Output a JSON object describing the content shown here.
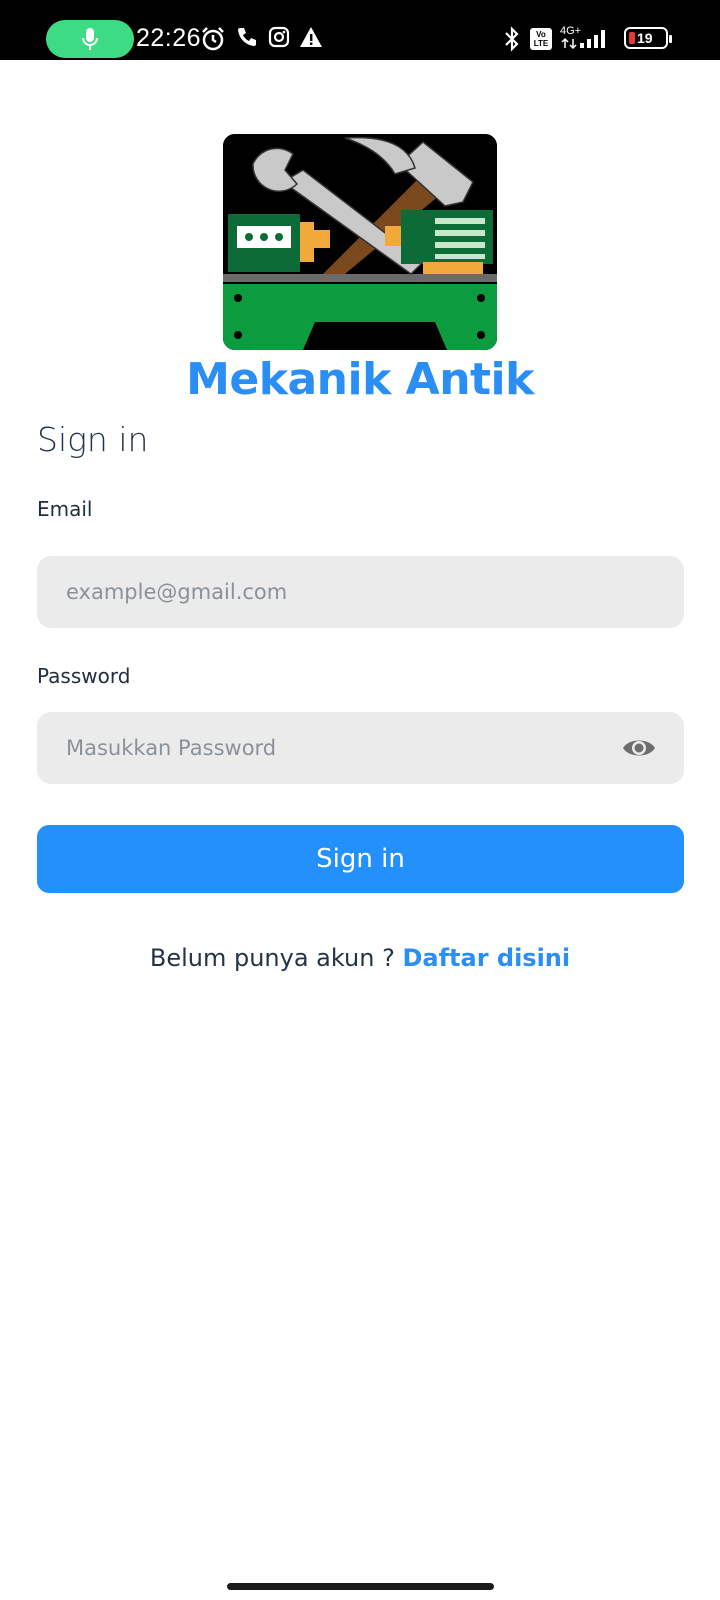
{
  "status_bar": {
    "time": "22:26",
    "battery_level": "19",
    "network": "4G+",
    "volte": "Vo LTE"
  },
  "app": {
    "name": "Mekanik Antik",
    "brand_color": "#2a8ef5"
  },
  "form": {
    "heading": "Sign in",
    "email_label": "Email",
    "email_placeholder": "example@gmail.com",
    "email_value": "",
    "password_label": "Password",
    "password_placeholder": "Masukkan Password",
    "password_value": "",
    "submit_label": "Sign in",
    "submit_color": "#2490fb"
  },
  "register": {
    "prompt": "Belum punya akun ? ",
    "link": "Daftar disini"
  },
  "icons": {
    "status_bar": [
      "mic-icon",
      "alarm-icon",
      "phone-icon",
      "instagram-icon",
      "warning-icon",
      "bluetooth-icon",
      "volte-icon",
      "signal-icon",
      "battery-icon"
    ],
    "password_toggle": "eye-icon"
  }
}
